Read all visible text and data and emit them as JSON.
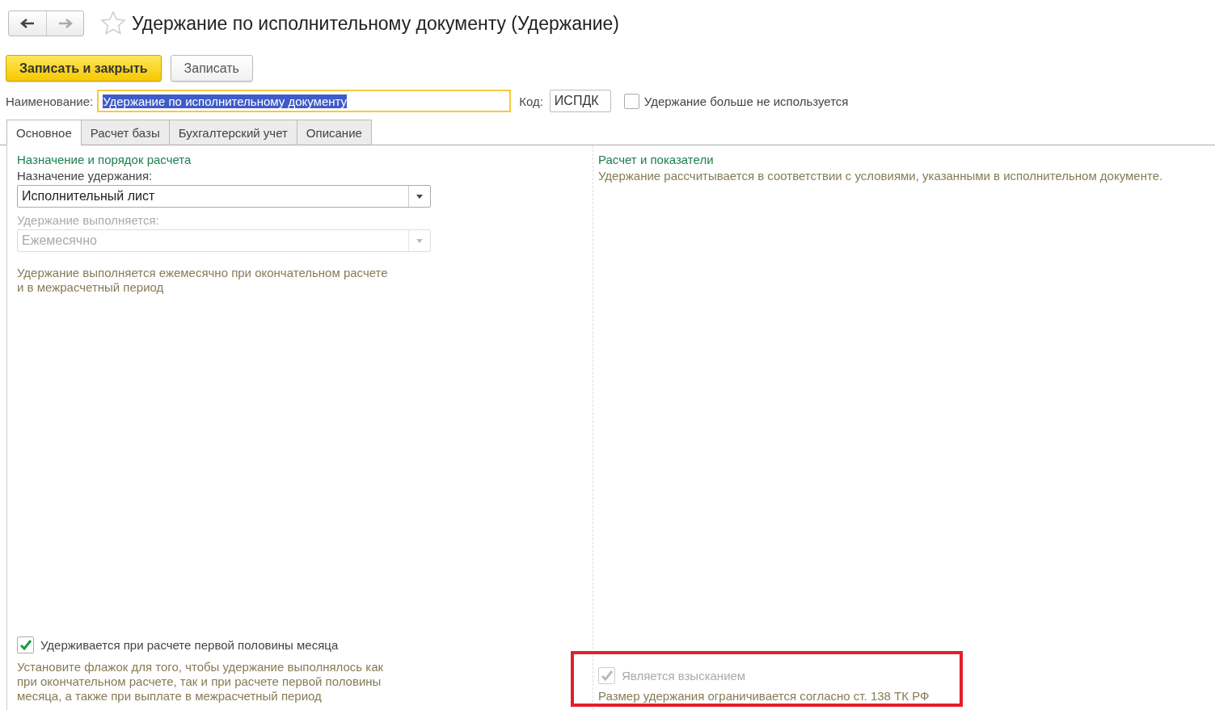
{
  "nav": {
    "back_disabled": false,
    "forward_disabled": true
  },
  "favorite": false,
  "title": "Удержание по исполнительному документу (Удержание)",
  "toolbar": [
    {
      "label": "Записать и закрыть",
      "primary": true
    },
    {
      "label": "Записать",
      "primary": false
    }
  ],
  "name_field": {
    "label": "Наименование:",
    "value": "Удержание по исполнительному документу",
    "text_selected": true
  },
  "code_field": {
    "label": "Код:",
    "value": "ИСПДК"
  },
  "unused_checkbox": {
    "label": "Удержание больше не используется",
    "checked": false
  },
  "tabs": [
    {
      "label": "Основное",
      "selected": true
    },
    {
      "label": "Расчет базы",
      "selected": false
    },
    {
      "label": "Бухгалтерский учет",
      "selected": false
    },
    {
      "label": "Описание",
      "selected": false
    }
  ],
  "left": {
    "heading": "Назначение и порядок расчета",
    "fields": [
      {
        "label": "Назначение удержания:",
        "value": "Исполнительный лист",
        "disabled": false
      },
      {
        "label": "Удержание выполняется:",
        "value": "Ежемесячно",
        "disabled": true
      }
    ],
    "hint": "Удержание выполняется ежемесячно при окончательном расчете\nи в межрасчетный период",
    "checkbox": {
      "label": "Удерживается при расчете первой половины месяца",
      "checked": true,
      "disabled": false
    },
    "checkbox_hint": "Установите флажок для того, чтобы удержание выполнялось как\nпри окончательном расчете, так и при расчете первой половины\nмесяца, а также при выплате в межрасчетный период"
  },
  "right": {
    "heading": "Расчет и показатели",
    "hint": "Удержание рассчитывается в соответствии с условиями, указанными в исполнительном документе.",
    "checkbox": {
      "label": "Является взысканием",
      "checked": true,
      "disabled": true
    },
    "checkbox_hint": "Размер удержания ограничивается согласно ст. 138 ТК РФ",
    "highlighted": true
  }
}
